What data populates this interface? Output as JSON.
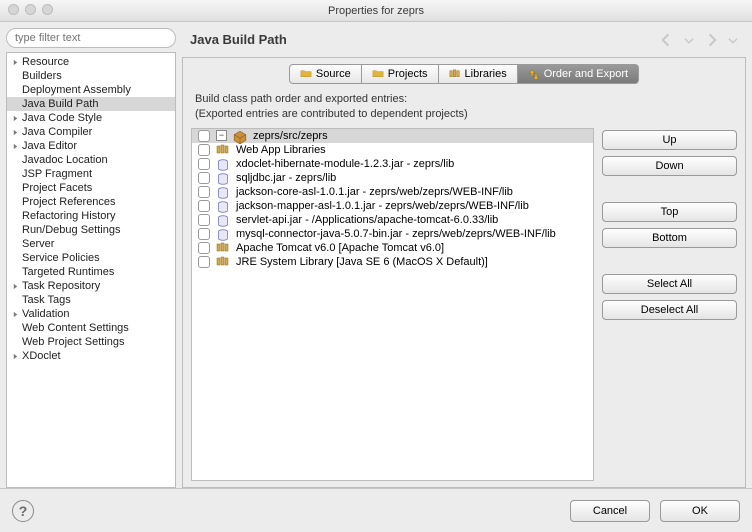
{
  "window": {
    "title": "Properties for zeprs"
  },
  "filter": {
    "placeholder": "type filter text"
  },
  "sidebar": {
    "nodes": [
      {
        "label": "Resource",
        "expandable": true,
        "depth": 0
      },
      {
        "label": "Builders",
        "expandable": false,
        "depth": 0
      },
      {
        "label": "Deployment Assembly",
        "expandable": false,
        "depth": 0
      },
      {
        "label": "Java Build Path",
        "expandable": false,
        "depth": 0,
        "selected": true
      },
      {
        "label": "Java Code Style",
        "expandable": true,
        "depth": 0
      },
      {
        "label": "Java Compiler",
        "expandable": true,
        "depth": 0
      },
      {
        "label": "Java Editor",
        "expandable": true,
        "depth": 0
      },
      {
        "label": "Javadoc Location",
        "expandable": false,
        "depth": 0
      },
      {
        "label": "JSP Fragment",
        "expandable": false,
        "depth": 0
      },
      {
        "label": "Project Facets",
        "expandable": false,
        "depth": 0
      },
      {
        "label": "Project References",
        "expandable": false,
        "depth": 0
      },
      {
        "label": "Refactoring History",
        "expandable": false,
        "depth": 0
      },
      {
        "label": "Run/Debug Settings",
        "expandable": false,
        "depth": 0
      },
      {
        "label": "Server",
        "expandable": false,
        "depth": 0
      },
      {
        "label": "Service Policies",
        "expandable": false,
        "depth": 0
      },
      {
        "label": "Targeted Runtimes",
        "expandable": false,
        "depth": 0
      },
      {
        "label": "Task Repository",
        "expandable": true,
        "depth": 0
      },
      {
        "label": "Task Tags",
        "expandable": false,
        "depth": 0
      },
      {
        "label": "Validation",
        "expandable": true,
        "depth": 0
      },
      {
        "label": "Web Content Settings",
        "expandable": false,
        "depth": 0
      },
      {
        "label": "Web Project Settings",
        "expandable": false,
        "depth": 0
      },
      {
        "label": "XDoclet",
        "expandable": true,
        "depth": 0
      }
    ]
  },
  "main": {
    "title": "Java Build Path",
    "tabs": [
      {
        "label": "Source",
        "icon": "folder",
        "active": false
      },
      {
        "label": "Projects",
        "icon": "folder",
        "active": false
      },
      {
        "label": "Libraries",
        "icon": "lib",
        "active": false
      },
      {
        "label": "Order and Export",
        "icon": "updown",
        "active": true
      }
    ],
    "desc1": "Build class path order and exported entries:",
    "desc2": "(Exported entries are contributed to dependent projects)",
    "entries": [
      {
        "label": "zeprs/src/zeprs",
        "icon": "pkg",
        "collapser": true,
        "selected": true
      },
      {
        "label": "Web App Libraries",
        "icon": "lib"
      },
      {
        "label": "xdoclet-hibernate-module-1.2.3.jar - zeprs/lib",
        "icon": "jar"
      },
      {
        "label": "sqljdbc.jar - zeprs/lib",
        "icon": "jar"
      },
      {
        "label": "jackson-core-asl-1.0.1.jar - zeprs/web/zeprs/WEB-INF/lib",
        "icon": "jar"
      },
      {
        "label": "jackson-mapper-asl-1.0.1.jar - zeprs/web/zeprs/WEB-INF/lib",
        "icon": "jar"
      },
      {
        "label": "servlet-api.jar - /Applications/apache-tomcat-6.0.33/lib",
        "icon": "jar"
      },
      {
        "label": "mysql-connector-java-5.0.7-bin.jar - zeprs/web/zeprs/WEB-INF/lib",
        "icon": "jar"
      },
      {
        "label": "Apache Tomcat v6.0 [Apache Tomcat v6.0]",
        "icon": "lib"
      },
      {
        "label": "JRE System Library [Java SE 6 (MacOS X Default)]",
        "icon": "lib"
      }
    ],
    "buttons": {
      "up": "Up",
      "down": "Down",
      "top": "Top",
      "bottom": "Bottom",
      "select_all": "Select All",
      "deselect_all": "Deselect All"
    }
  },
  "footer": {
    "cancel": "Cancel",
    "ok": "OK"
  }
}
